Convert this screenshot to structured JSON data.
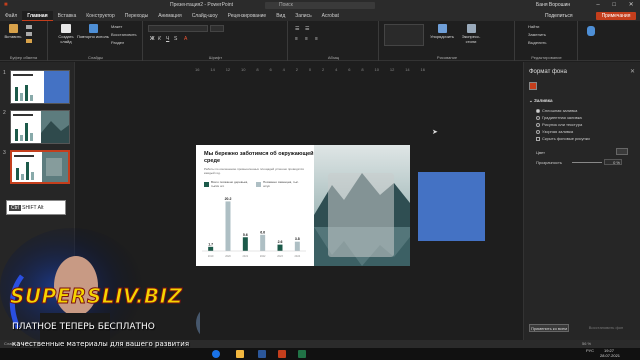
{
  "titlebar": {
    "title": "Презентация2 - PowerPoint",
    "search": "Поиск",
    "user": "Баня Ворошин"
  },
  "tabs": [
    "Файл",
    "Главная",
    "Вставка",
    "Конструктор",
    "Переходы",
    "Анимация",
    "Слайд-шоу",
    "Рецензирование",
    "Вид",
    "Запись",
    "Acrobat"
  ],
  "share_label": "Поделиться",
  "present_label": "Примечания",
  "ribbon": {
    "clipboard": {
      "paste": "Вставить",
      "label": "Буфер обмена"
    },
    "slides": {
      "new_slide": "Создать слайд",
      "reuse": "Повторно использовать слайды",
      "layout": "Макет",
      "reset": "Восстановить",
      "section": "Раздел",
      "label": "Слайды"
    },
    "font_label": "Шрифт",
    "paragraph_label": "Абзац",
    "drawing": {
      "shapes": "Фигуры",
      "arrange": "Упорядочить",
      "styles": "Экспресс-стили",
      "label": "Рисование"
    },
    "editing": {
      "find": "Найти",
      "replace": "Заменить",
      "select": "Выделить",
      "label": "Редактирование"
    }
  },
  "thumbs": {
    "numbers": [
      "1",
      "2",
      "3"
    ]
  },
  "ruler_ticks": [
    "16",
    "14",
    "12",
    "10",
    "8",
    "6",
    "4",
    "2",
    "0",
    "2",
    "4",
    "6",
    "8",
    "10",
    "12",
    "14",
    "16"
  ],
  "slide": {
    "headline": "Мы бережно заботимся об окружающей среде",
    "subtext": "Работы по озеленению промышленных площадей успешно проводятся каждый год.",
    "legend": [
      "Всего посажено деревьев, тысяч шт.",
      "Посажено саженцев, тыс. штук"
    ],
    "chart_values": [
      "1.7",
      "20.2",
      "5.6",
      "6.6",
      "2.6",
      "3.8"
    ]
  },
  "pane": {
    "title": "Формат фона",
    "section": "Заливка",
    "options": [
      "Сплошная заливка",
      "Градиентная заливка",
      "Рисунок или текстура",
      "Узорная заливка",
      "Скрыть фоновые рисунки"
    ],
    "color_label": "Цвет",
    "transparency_label": "Прозрачность",
    "transparency_value": "0 %",
    "apply_all": "Применить ко всем",
    "reset": "Восстановить фон"
  },
  "statusbar": {
    "slide_info": "Слайд 3 из 4",
    "zoom": "56 %"
  },
  "clock": {
    "time": "19:27",
    "date": "28.07.2021",
    "lang": "РУС"
  },
  "overlay": {
    "brand": "SUPERSLIV.BIZ",
    "tagline": "ПЛАТНОЕ ТЕПЕРЬ БЕСПЛАТНО",
    "tagline2": "качественные материалы для вашего развития"
  },
  "tooltip": {
    "ctrl": "Ctrl",
    "shift": "SHIFT Alt"
  },
  "chart_data": {
    "type": "bar",
    "categories": [
      "2019",
      "2020",
      "2021",
      "2022",
      "2023",
      "2024"
    ],
    "values": [
      1.7,
      20.2,
      5.6,
      6.6,
      2.6,
      3.8
    ],
    "title": "",
    "ylim": [
      0,
      22
    ]
  }
}
